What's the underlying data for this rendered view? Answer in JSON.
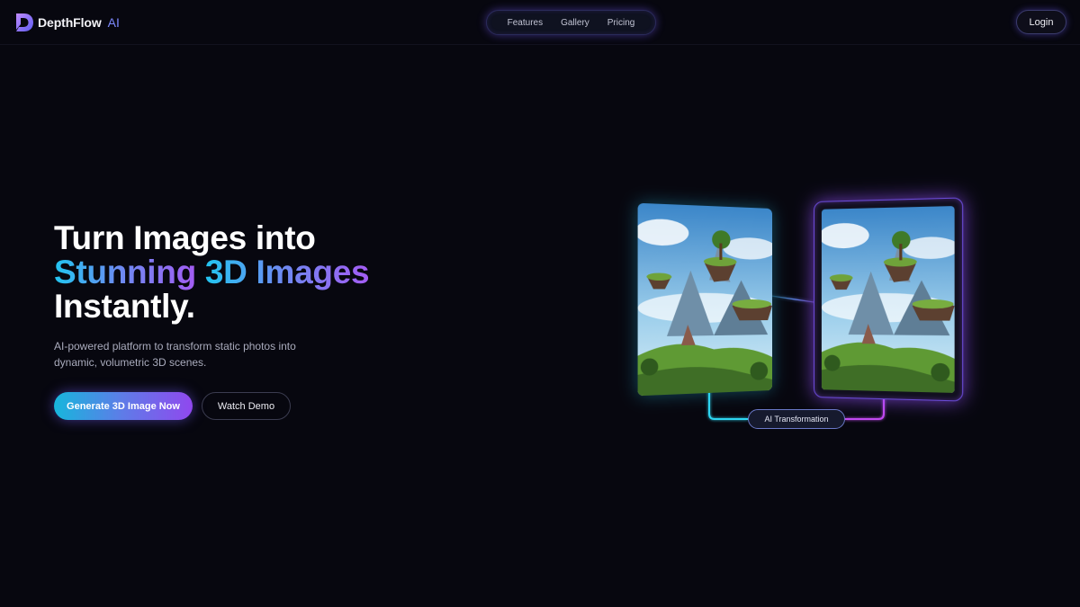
{
  "brand": {
    "name": "DepthFlow",
    "suffix": "AI",
    "logo_icon": "depthflow-logo-icon"
  },
  "nav": {
    "links": [
      {
        "label": "Features"
      },
      {
        "label": "Gallery"
      },
      {
        "label": "Pricing"
      }
    ]
  },
  "header": {
    "login_label": "Login"
  },
  "hero": {
    "title_line1": "Turn Images into",
    "title_grad1": "Stunning",
    "title_grad2": "3D Images",
    "title_line3": "Instantly.",
    "subtitle": "AI-powered platform to transform static photos into dynamic, volumetric 3D scenes.",
    "primary_cta": "Generate 3D Image Now",
    "secondary_cta": "Watch Demo"
  },
  "illustration": {
    "badge_label": "AI Transformation",
    "left_image": "floating-islands-landscape",
    "right_image": "floating-islands-landscape-3d"
  },
  "colors": {
    "background": "#07070f",
    "accent_cyan": "#22c5f0",
    "accent_blue": "#6b8cf2",
    "accent_purple": "#a35cf3"
  }
}
